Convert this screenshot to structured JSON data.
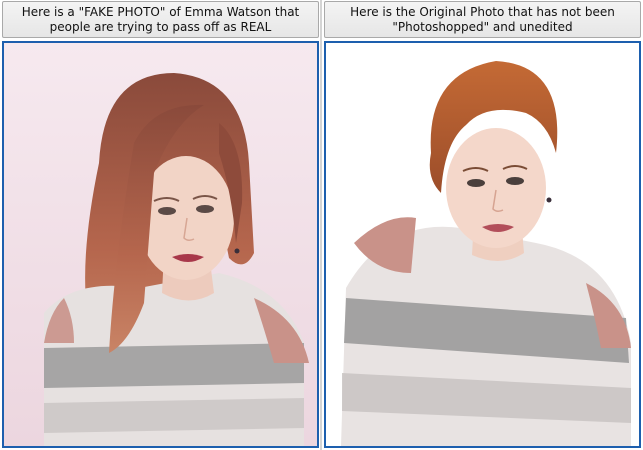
{
  "panels": [
    {
      "caption": "Here is a \"FAKE PHOTO\" of Emma Watson that people are trying to pass off as REAL",
      "image": "emma-watson-long-hair-photo"
    },
    {
      "caption": "Here is the Original Photo that has not been \"Photoshopped\" and unedited",
      "image": "emma-watson-short-hair-photo"
    }
  ],
  "colors": {
    "frame_border": "#1d5fae",
    "caption_bg": "#ececec",
    "left_background": "#f4e6ec",
    "right_background": "#ffffff",
    "long_hair": "#a0553f",
    "short_hair": "#b65a2c",
    "sweater_light": "#e9e4e3",
    "sweater_gray": "#8f9090",
    "sweater_pink": "#c79088"
  }
}
